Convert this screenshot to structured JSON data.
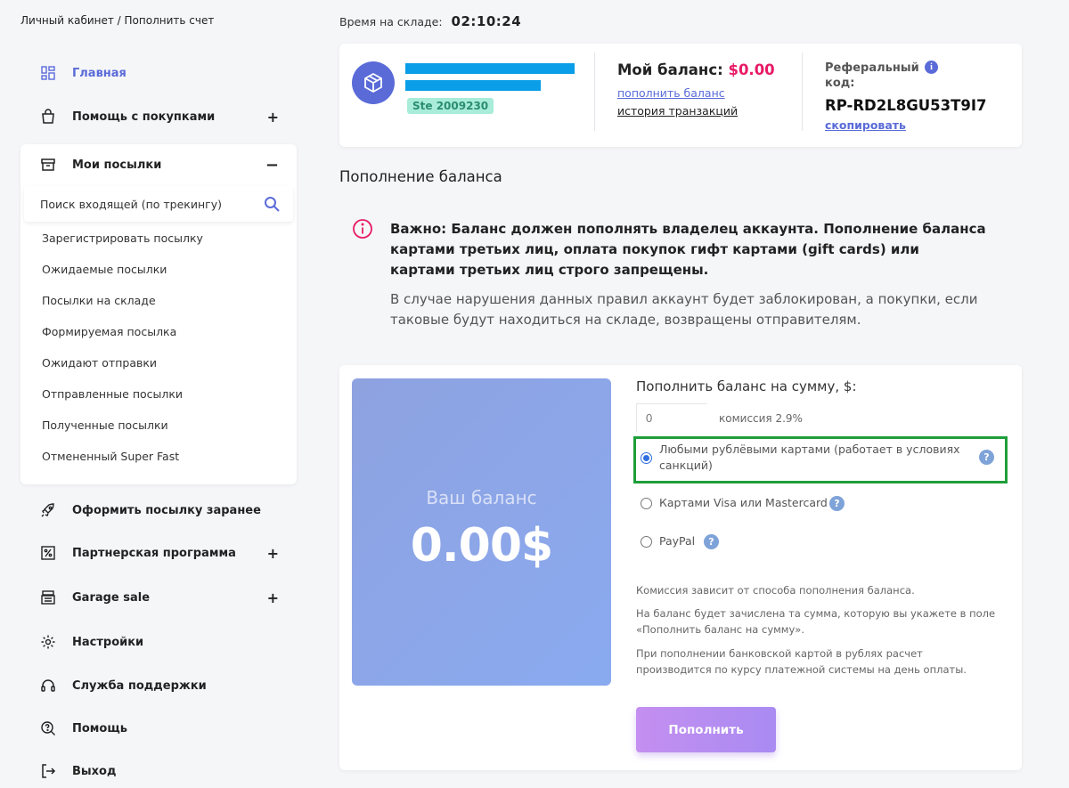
{
  "breadcrumb": "Личный кабинет / Пополнить счет",
  "sidebar": {
    "home": "Главная",
    "shopping_help": "Помощь с покупками",
    "my_parcels": "Мои посылки",
    "search_placeholder": "Поиск входящей (по трекингу)",
    "parcel_items": [
      "Зарегистрировать посылку",
      "Ожидаемые посылки",
      "Посылки на складе",
      "Формируемая посылка",
      "Ожидают отправки",
      "Отправленные посылки",
      "Полученные посылки",
      "Отмененный Super Fast"
    ],
    "preorder": "Оформить посылку заранее",
    "partner": "Партнерская программа",
    "garage_sale": "Garage sale",
    "settings": "Настройки",
    "support": "Служба поддержки",
    "help": "Помощь",
    "logout": "Выход",
    "plus": "+",
    "minus": "−"
  },
  "warehouse": {
    "label": "Время на складе:",
    "time": "02:10:24"
  },
  "account": {
    "ste_badge": "Ste 2009230",
    "balance_label": "Мой баланс:",
    "balance_value": "$0.00",
    "topup_link": "пополнить баланс",
    "history_link": "история транзакций",
    "ref_label": "Реферальный код:",
    "ref_code": "RP-RD2L8GU53T9I7",
    "copy_link": "скопировать"
  },
  "section_title": "Пополнение баланса",
  "warning": {
    "bold": "Важно: Баланс должен пополнять владелец аккаунта. Пополнение баланса картами третьих лиц, оплата покупок гифт картами (gift cards) или картами третьих лиц строго запрещены.",
    "normal": "В случае нарушения данных правил аккаунт будет заблокирован, а покупки, если таковые будут находиться на складе, возвращены отправителям."
  },
  "topup": {
    "balance_label": "Ваш баланс",
    "balance_value": "0.00$",
    "amount_label": "Пополнить баланс на сумму, $:",
    "amount_placeholder": "0",
    "commission": "комиссия 2.9%",
    "options": [
      {
        "label": "Любыми рублёвыми картами (работает в условиях санкций)",
        "checked": true
      },
      {
        "label": "Картами Visa или Mastercard",
        "checked": false
      },
      {
        "label": "PayPal",
        "checked": false
      }
    ],
    "notes": [
      "Комиссия зависит от способа пополнения баланса.",
      "На баланс будет зачислена та сумма, которую вы укажете в поле «Пополнить баланс на сумму».",
      "При пополнении банковской картой в рублях расчет производится по курсу платежной системы на день оплаты."
    ],
    "button": "Пополнить"
  },
  "colors": {
    "accent": "#5a6bd8",
    "balance_red": "#e81a66",
    "highlight_green": "#1f9e3a",
    "info_bar": "#0a9ee8"
  }
}
